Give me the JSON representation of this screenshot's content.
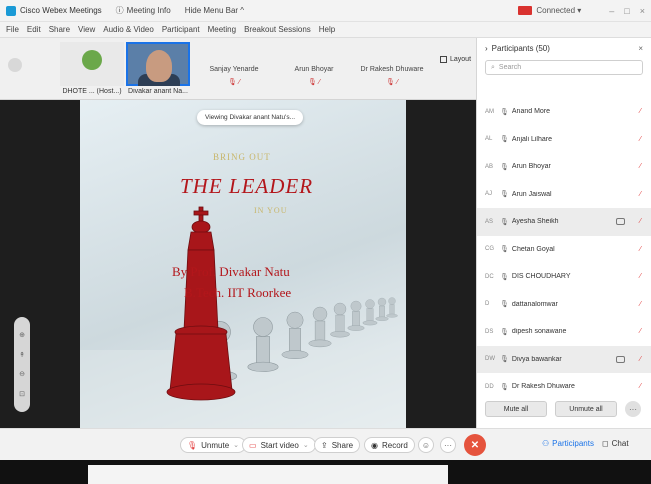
{
  "titlebar": {
    "app_title": "Cisco Webex Meetings",
    "meeting_info": "Meeting Info",
    "hide_menu": "Hide Menu Bar ^",
    "connected": "Connected ▾",
    "window_controls": [
      "–",
      "□",
      "×"
    ]
  },
  "menubar": {
    "items": [
      "File",
      "Edit",
      "Share",
      "View",
      "Audio & Video",
      "Participant",
      "Meeting",
      "Breakout Sessions",
      "Help"
    ]
  },
  "filmstrip": {
    "tiles": [
      {
        "name": "DHOTE ... (Host...)",
        "sublabel": ""
      },
      {
        "name": "Divakar anant Na...",
        "sublabel": ""
      },
      {
        "name": "",
        "sublabel": "Sanjay Yenarde"
      },
      {
        "name": "",
        "sublabel": "Arun Bhoyar"
      },
      {
        "name": "",
        "sublabel": "Dr Rakesh Dhuware"
      }
    ],
    "layout_label": "Layout"
  },
  "stage": {
    "viewing_banner": "Viewing Divakar anant Natu's...",
    "slide": {
      "line1": "BRING OUT",
      "line2": "THE LEADER",
      "line3": "IN YOU",
      "author_line1": "By Prof. Divakar Natu",
      "author_line2": "B.Tech. IIT Roorkee"
    }
  },
  "participants": {
    "title": "Participants (50)",
    "close": "×",
    "search_placeholder": "Search",
    "list": [
      {
        "initials": "AM",
        "name": "Anand More",
        "highlight": false,
        "video": false
      },
      {
        "initials": "AL",
        "name": "Anjali Lilhare",
        "highlight": false,
        "video": false
      },
      {
        "initials": "AB",
        "name": "Arun Bhoyar",
        "highlight": false,
        "video": false
      },
      {
        "initials": "AJ",
        "name": "Arun Jaiswal",
        "highlight": false,
        "video": false
      },
      {
        "initials": "AS",
        "name": "Ayesha Sheikh",
        "highlight": true,
        "video": true
      },
      {
        "initials": "CG",
        "name": "Chetan Goyal",
        "highlight": false,
        "video": false
      },
      {
        "initials": "DC",
        "name": "DIS CHOUDHARY",
        "highlight": false,
        "video": false
      },
      {
        "initials": "D",
        "name": "dattanalomwar",
        "highlight": false,
        "video": false
      },
      {
        "initials": "DS",
        "name": "dipesh sonawane",
        "highlight": false,
        "video": false
      },
      {
        "initials": "DW",
        "name": "Divya bawankar",
        "highlight": true,
        "video": true
      },
      {
        "initials": "DD",
        "name": "Dr Rakesh Dhuware",
        "highlight": false,
        "video": false
      }
    ],
    "mute_all": "Mute all",
    "unmute_all": "Unmute all",
    "more": "···"
  },
  "controlbar": {
    "unmute": "Unmute",
    "start_video": "Start video",
    "share": "Share",
    "record": "Record",
    "more": "···",
    "participants": "Participants",
    "chat": "Chat"
  }
}
